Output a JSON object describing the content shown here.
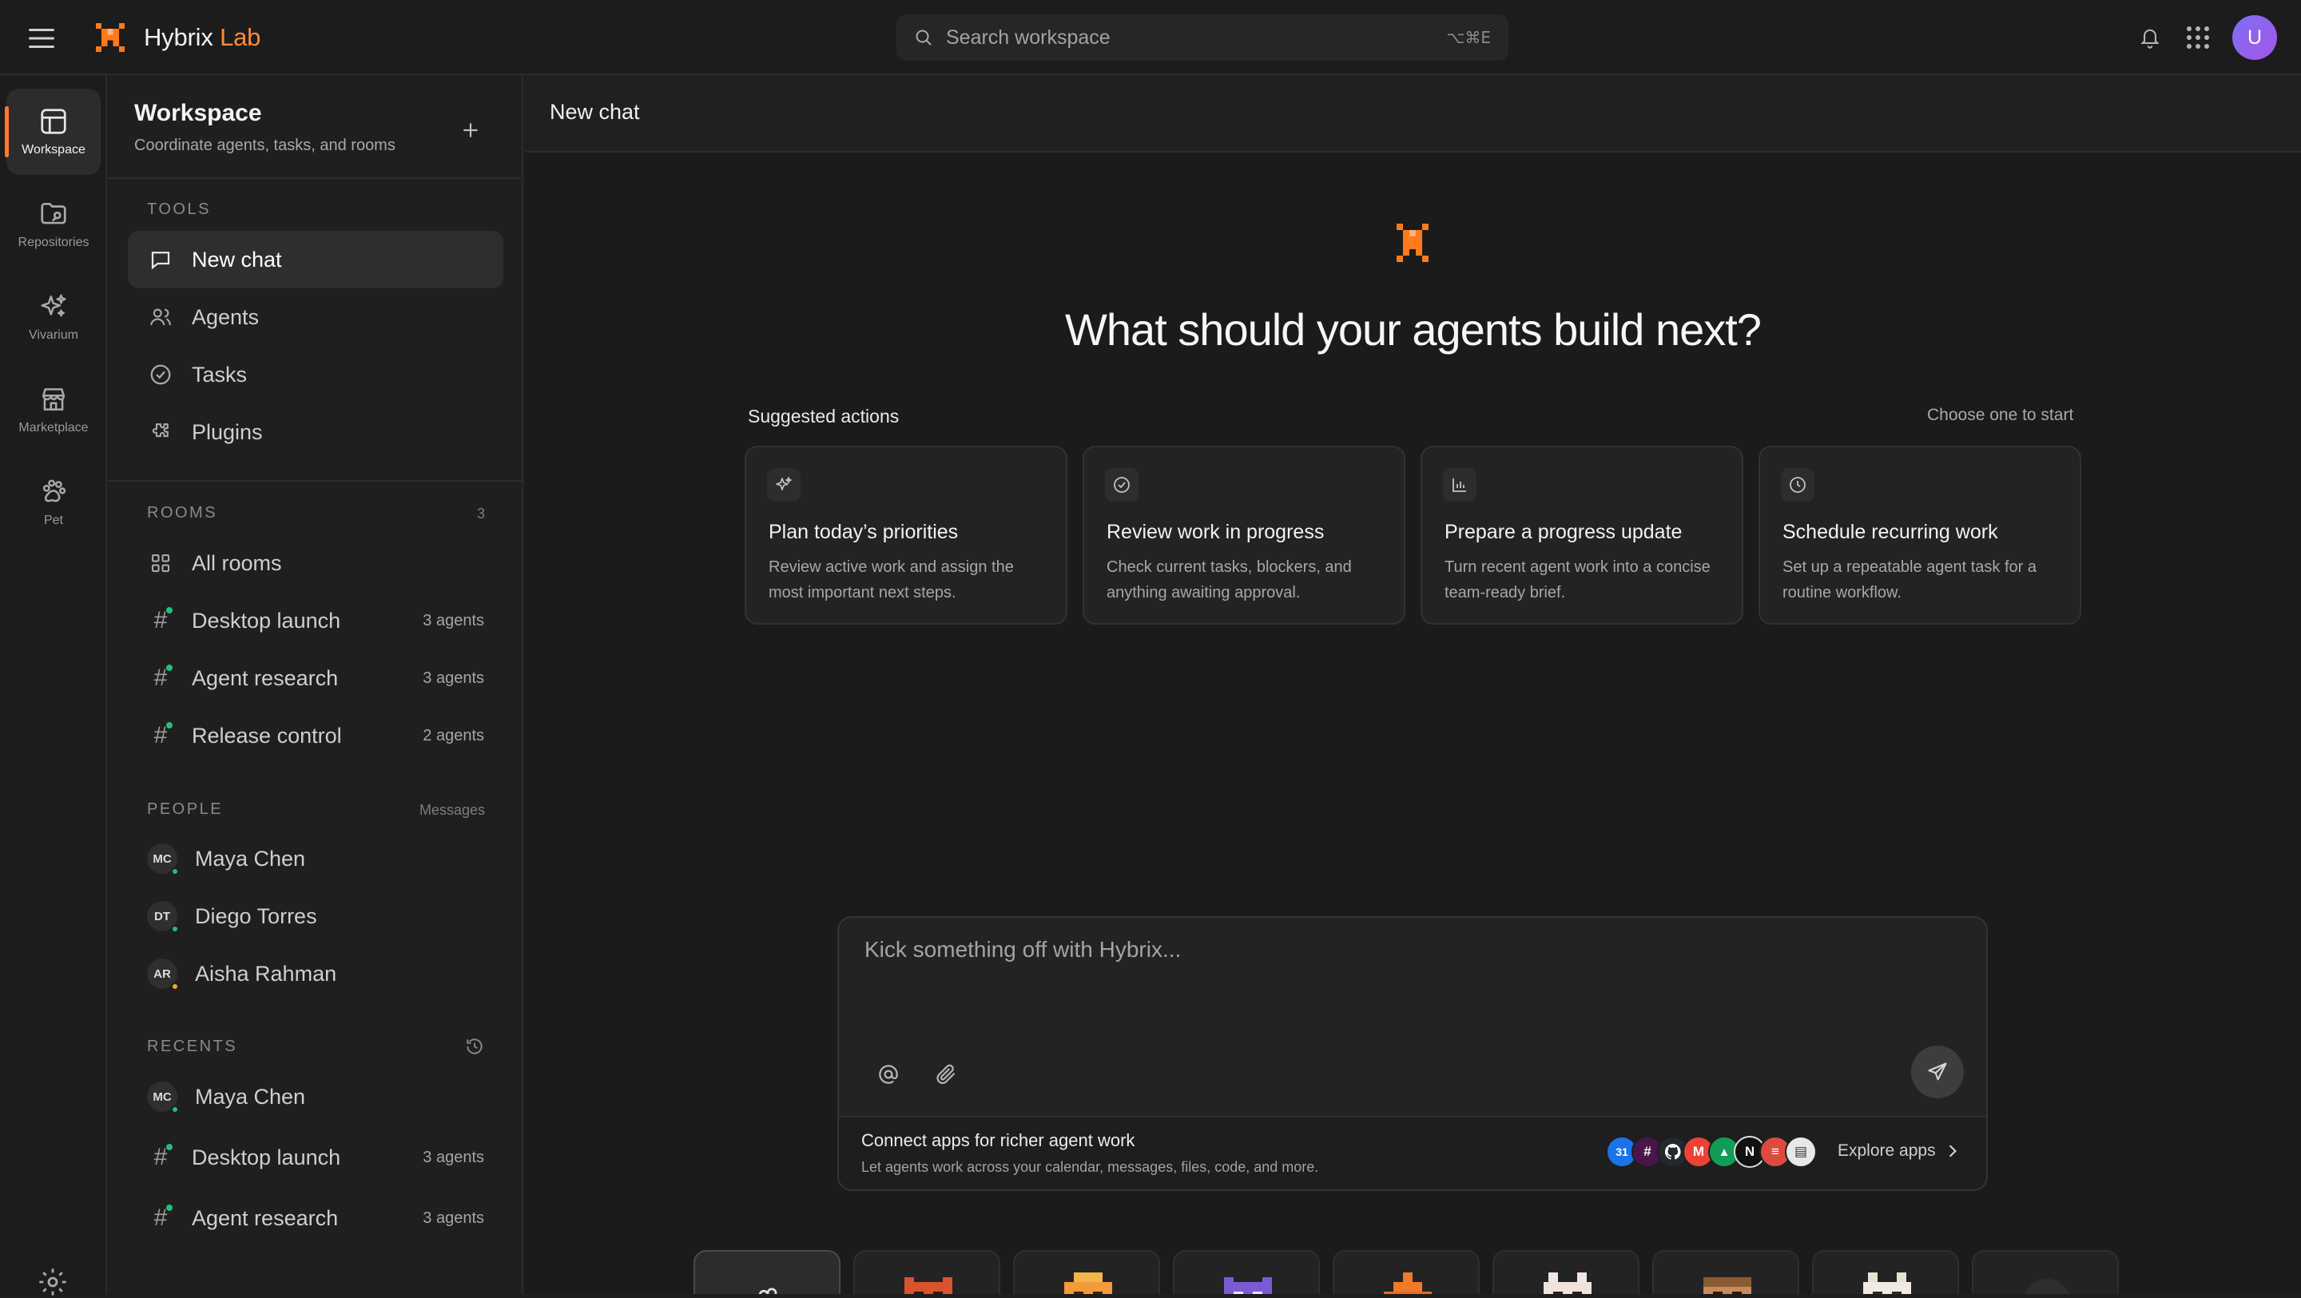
{
  "brand": {
    "name": "Hybrix",
    "suffix": "Lab",
    "accent_color": "#ff7a1a"
  },
  "topbar": {
    "search_placeholder": "Search workspace",
    "search_shortcut": "⌥⌘E",
    "avatar_initial": "U"
  },
  "rail": [
    {
      "label": "Workspace",
      "icon": "layout-icon",
      "active": true
    },
    {
      "label": "Repositories",
      "icon": "folder-icon"
    },
    {
      "label": "Vivarium",
      "icon": "sparkles-icon"
    },
    {
      "label": "Marketplace",
      "icon": "store-icon"
    },
    {
      "label": "Pet",
      "icon": "paw-icon"
    }
  ],
  "sidebar": {
    "title": "Workspace",
    "subtitle": "Coordinate agents, tasks, and rooms",
    "tools": {
      "header": "TOOLS",
      "items": [
        {
          "label": "New chat",
          "icon": "chat-icon",
          "active": true
        },
        {
          "label": "Agents",
          "icon": "users-icon"
        },
        {
          "label": "Tasks",
          "icon": "check-circle-icon"
        },
        {
          "label": "Plugins",
          "icon": "puzzle-icon"
        }
      ]
    },
    "rooms": {
      "header": "ROOMS",
      "count": "3",
      "all_label": "All rooms",
      "items": [
        {
          "label": "Desktop launch",
          "count": "3 agents"
        },
        {
          "label": "Agent research",
          "count": "3 agents"
        },
        {
          "label": "Release control",
          "count": "2 agents"
        }
      ]
    },
    "people": {
      "header": "PEOPLE",
      "action": "Messages",
      "items": [
        {
          "initials": "MC",
          "name": "Maya Chen",
          "status_color": "#22c07a"
        },
        {
          "initials": "DT",
          "name": "Diego Torres",
          "status_color": "#22c07a"
        },
        {
          "initials": "AR",
          "name": "Aisha Rahman",
          "status_color": "#f5a623"
        }
      ]
    },
    "recents": {
      "header": "RECENTS",
      "items": [
        {
          "initials": "MC",
          "name": "Maya Chen",
          "status_color": "#22c07a"
        },
        {
          "label": "Desktop launch",
          "count": "3 agents"
        },
        {
          "label": "Agent research",
          "count": "3 agents"
        }
      ]
    }
  },
  "main": {
    "title": "New chat",
    "hero_title": "What should your agents build next?",
    "suggested_label": "Suggested actions",
    "suggested_right": "Choose one to start",
    "cards": [
      {
        "title": "Plan today’s priorities",
        "desc": "Review active work and assign the most important next steps.",
        "icon": "sparkles-icon"
      },
      {
        "title": "Review work in progress",
        "desc": "Check current tasks, blockers, and anything awaiting approval.",
        "icon": "check-circle-icon"
      },
      {
        "title": "Prepare a progress update",
        "desc": "Turn recent agent work into a concise team-ready brief.",
        "icon": "bar-chart-icon"
      },
      {
        "title": "Schedule recurring work",
        "desc": "Set up a repeatable agent task for a routine workflow.",
        "icon": "clock-icon"
      }
    ],
    "composer": {
      "placeholder": "Kick something off with Hybrix...",
      "connect_title": "Connect apps for richer agent work",
      "connect_sub": "Let agents work across your calendar, messages, files, code, and more.",
      "explore_label": "Explore apps",
      "apps": [
        {
          "name": "calendar-app-icon",
          "letter": "31",
          "color": "#1a73e8"
        },
        {
          "name": "slack-app-icon",
          "letter": "#",
          "color": "#4a154b"
        },
        {
          "name": "github-app-icon",
          "letter": "",
          "color": "#24292f"
        },
        {
          "name": "gmail-app-icon",
          "letter": "M",
          "color": "#ea4335"
        },
        {
          "name": "drive-app-icon",
          "letter": "▲",
          "color": "#0f9d58"
        },
        {
          "name": "notion-app-icon",
          "letter": "N",
          "color": "#111111"
        },
        {
          "name": "todoist-app-icon",
          "letter": "≡",
          "color": "#db4c3f"
        },
        {
          "name": "bookmark-app-icon",
          "letter": "▤",
          "color": "#e8e8e8"
        }
      ]
    }
  }
}
